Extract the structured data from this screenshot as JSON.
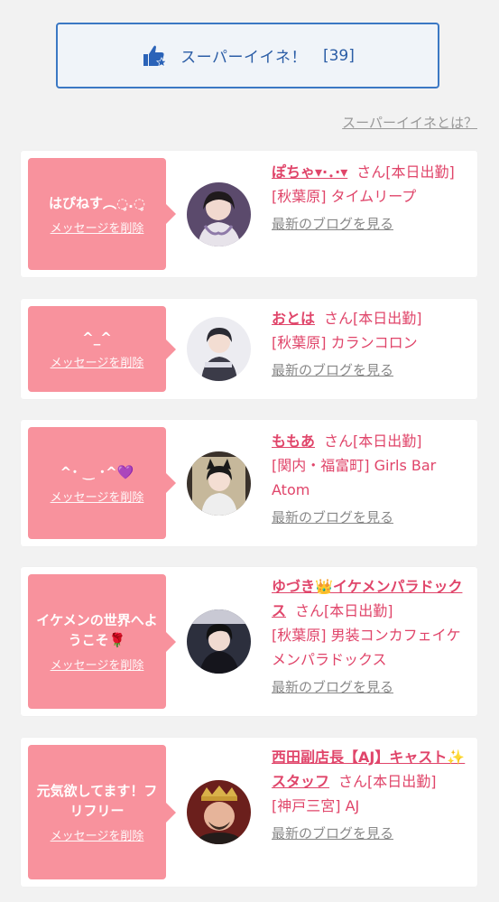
{
  "superlike": {
    "icon": "thumbs-up-star-icon",
    "label": "スーパーイイネ！",
    "count": "[39]"
  },
  "what_link": "スーパーイイネとは？",
  "cards": [
    {
      "message": "はぴねす︵◌̥.◌̥",
      "delete_label": "メッセージを削除",
      "name": "ぽちゃ▾·．·▾",
      "san_status": "さん[本日出勤]",
      "location": "[秋葉原] タイムリープ",
      "blog_label": "最新のブログを見る",
      "avatar_color": "#6a4f7a"
    },
    {
      "message": "^_^",
      "delete_label": "メッセージを削除",
      "name": "おとは",
      "san_status": "さん[本日出勤]",
      "location": "[秋葉原] カランコロン",
      "blog_label": "最新のブログを見る",
      "avatar_color": "#b9b9c4"
    },
    {
      "message": "^･ ‿ ･^💜",
      "delete_label": "メッセージを削除",
      "name": "ももあ",
      "san_status": "さん[本日出勤]",
      "location": "[関内・福富町] Girls Bar Atom",
      "blog_label": "最新のブログを見る",
      "avatar_color": "#3a332e"
    },
    {
      "message": "イケメンの世界へようこそ🌹",
      "delete_label": "メッセージを削除",
      "name": "ゆづき👑イケメンパラドックス",
      "san_status": "さん[本日出勤]",
      "location": "[秋葉原] 男装コンカフェイケメンパラドックス",
      "blog_label": "最新のブログを見る",
      "avatar_color": "#2c2f3d"
    },
    {
      "message": "元気欲してます！フリフリー",
      "delete_label": "メッセージを削除",
      "name": "西田副店長【AJ】キャスト✨スタッフ",
      "san_status": "さん[本日出勤]",
      "location": "[神戸三宮] AJ",
      "blog_label": "最新のブログを見る",
      "avatar_color": "#7a2a24"
    }
  ]
}
